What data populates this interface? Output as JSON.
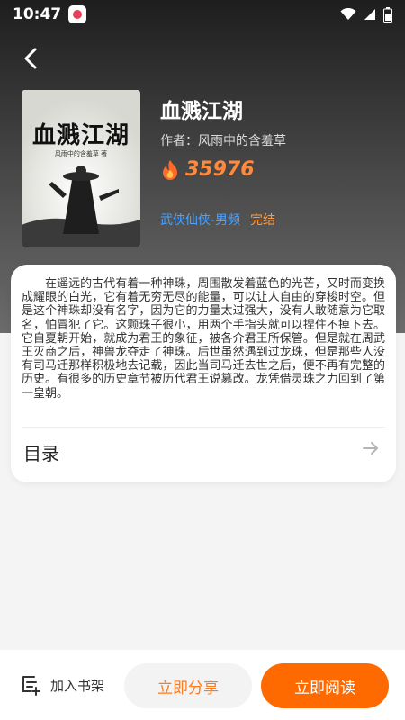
{
  "status_bar": {
    "time": "10:47",
    "icons": [
      "app-notification-icon",
      "wifi-icon",
      "signal-icon",
      "battery-icon"
    ]
  },
  "book": {
    "cover_title": "血溅江湖",
    "cover_author": "风雨中的含羞草 著",
    "title": "血溅江湖",
    "author": "作者：风雨中的含羞草",
    "heat": "35976",
    "genre": "武侠仙侠-男频",
    "status": "完结"
  },
  "intro": "在遥远的古代有着一种神珠，周围散发着蓝色的光芒，又时而变换成耀眼的白光，它有着无穷无尽的能量，可以让人自由的穿梭时空。但是这个神珠却没有名字，因为它的力量太过强大，没有人敢随意为它取名，怕冒犯了它。这颗珠子很小，用两个手指头就可以捏住不掉下去。它自夏朝开始，就成为君王的象征，被各介君王所保管。但是就在周武王灭商之后，神兽龙夺走了神珠。后世虽然遇到过龙珠，但是那些人没有司马迁那样积极地去记载，因此当司马迁去世之后，便不再有完整的历史。有很多的历史章节被历代君王说篡改。龙凭借灵珠之力回到了第一皇朝。",
  "toc": {
    "label": "目录"
  },
  "bottom_bar": {
    "shelf_label": "加入书架",
    "share_label": "立即分享",
    "read_label": "立即阅读"
  },
  "colors": {
    "accent": "#ff6a00",
    "heat": "#ff8a3d",
    "genre": "#4ba3ff",
    "status": "#ff9a3c"
  }
}
